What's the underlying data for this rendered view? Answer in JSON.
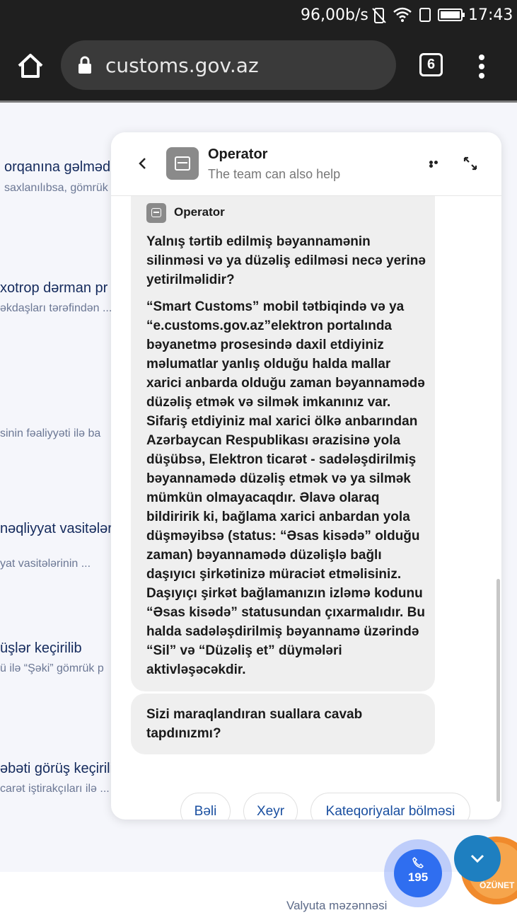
{
  "status_bar": {
    "net_speed": "96,00b/s",
    "time": "17:43",
    "icons": [
      "vibrate-icon",
      "wifi-icon",
      "sim-icon",
      "battery-icon"
    ]
  },
  "browser": {
    "url": "customs.gov.az",
    "tab_count": "6"
  },
  "background_page": {
    "items": [
      {
        "title": "orqanına gəlməd",
        "sub": "saxlanılıbsa, gömrük"
      },
      {
        "title": "xotrop dərman pr",
        "sub": "əkdaşları tərəfindən ..."
      },
      {
        "title": "",
        "sub": "sinin fəaliyyəti ilə ba"
      },
      {
        "title": "nəqliyyat vasitələri",
        "sub": "yat vasitələrinin ..."
      },
      {
        "title": "üşlər keçirilib",
        "sub": "ü ilə “Şəki” gömrük p"
      },
      {
        "title": "əbəti görüş keçirili",
        "sub": "carət iştirakçıları ilə ..."
      }
    ],
    "footer_link": "Valyuta məzənnəsi"
  },
  "chat": {
    "header": {
      "name": "Operator",
      "subtitle": "The team can also help"
    },
    "message": {
      "sender": "Operator",
      "question": "Yalnış tərtib edilmiş bəyannamənin silinməsi və ya düzəliş edilməsi necə yerinə yetirilməlidir?",
      "answer": "“Smart Customs” mobil tətbiqində və ya “e.customs.gov.az”elektron portalında bəyanetmə prosesində daxil etdiyiniz məlumatlar yanlış olduğu halda mallar xarici anbarda olduğu zaman bəyannamədə düzəliş etmək və silmək imkanınız var. Sifariş etdiyiniz mal xarici ölkə anbarından Azərbaycan Respublikası ərazisinə yola düşübsə, Elektron ticarət - sadələşdirilmiş bəyannamədə düzəliş etmək və ya silmək mümkün olmayacaqdır. Əlavə olaraq bildiririk ki, bağlama xarici anbardan yola düşməyibsə (status: “Əsas kisədə” olduğu zaman) bəyannamədə düzəlişlə bağlı daşıyıcı şirkətinizə müraciət etməlisiniz. Daşıyıçı şirkət bağlamanızın izləmə kodunu “Əsas kisədə” statusundan çıxarmalıdır. Bu halda sadələşdirilmiş bəyannamə üzərində “Sil” və “Düzəliş et” düymələri aktivləşəcəkdir."
    },
    "followup": "Sizi maraqlandıran suallara cavab tapdınızmı?",
    "quick_replies": {
      "yes": "Bəli",
      "no": "Xeyr",
      "categories": "Kateqoriyalar bölməsi"
    }
  },
  "floating": {
    "call_number": "195",
    "asan_label": "ÖZÜNET"
  }
}
